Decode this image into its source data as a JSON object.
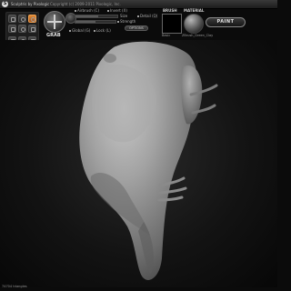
{
  "app": {
    "title": "Sculptris by Pixologic",
    "copyright": "Copyright (c) 2009-2011 Pixologic, Inc."
  },
  "tool": {
    "name": "GRAB",
    "options": {
      "airbrush_label": "Airbrush",
      "airbrush_key": "(C)",
      "invert_label": "Invert",
      "invert_key": "(X)",
      "size_label": "Size",
      "strength_label": "Strength",
      "detail_label": "Detail",
      "detail_key": "(Q)",
      "global_label": "Global",
      "global_key": "(G)",
      "lock_label": "Lock",
      "lock_key": "(L)",
      "options_button": "OPTIONS",
      "size_value": 0.55,
      "strength_value": 0.5
    }
  },
  "brush": {
    "label": "BRUSH",
    "name": "Basic"
  },
  "material": {
    "label": "MATERIAL",
    "name": "ZBrush_Green_Clay"
  },
  "paint_button": "PAINT",
  "status": {
    "triangles": "74704 triangles"
  },
  "colors": {
    "accent": "#e08a35",
    "clay": "#9a9a9a",
    "background": "#0b0b0b"
  }
}
